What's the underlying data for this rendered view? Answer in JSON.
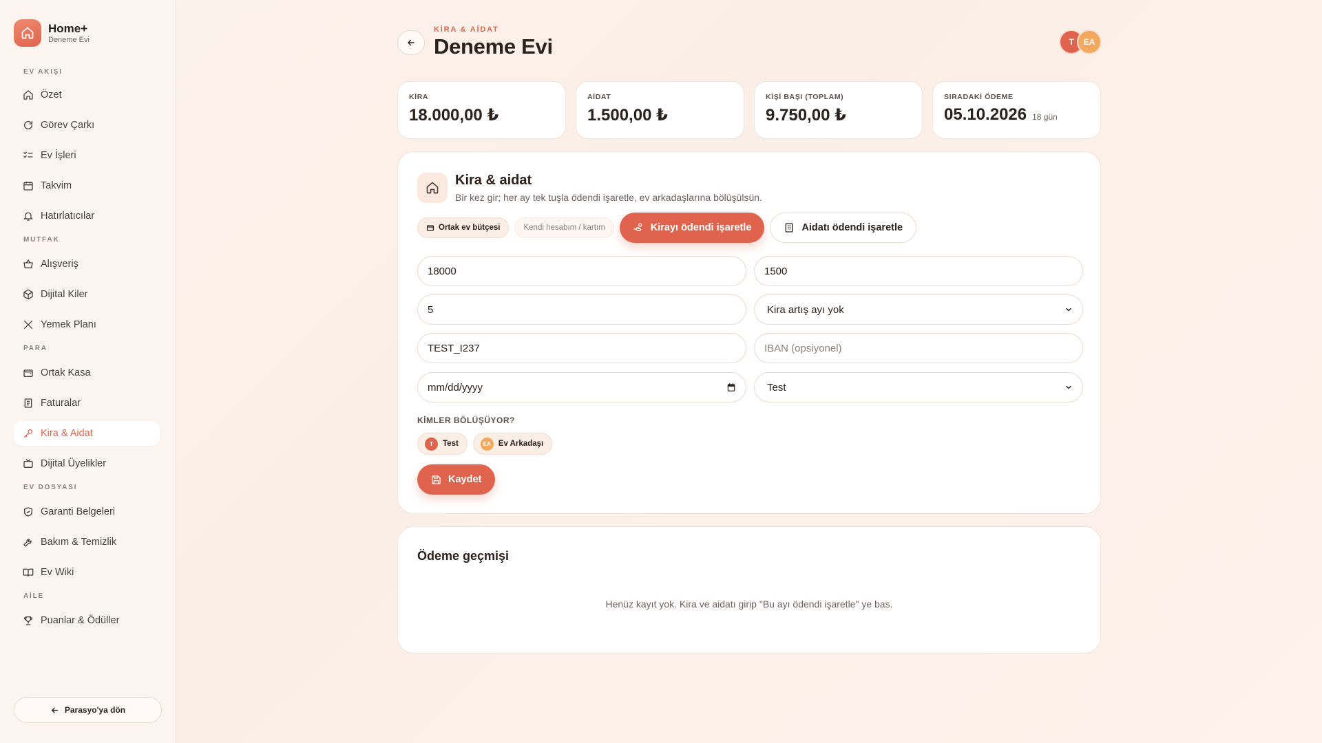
{
  "brand": {
    "title": "Home+",
    "subtitle": "Deneme Evi"
  },
  "sidebar": {
    "sections": [
      {
        "label": "EV AKIŞI",
        "items": [
          {
            "label": "Özet",
            "icon": "home-icon"
          },
          {
            "label": "Görev Çarkı",
            "icon": "refresh-icon"
          },
          {
            "label": "Ev İşleri",
            "icon": "checklist-icon"
          },
          {
            "label": "Takvim",
            "icon": "calendar-icon"
          },
          {
            "label": "Hatırlatıcılar",
            "icon": "bell-icon"
          }
        ]
      },
      {
        "label": "MUTFAK",
        "items": [
          {
            "label": "Alışveriş",
            "icon": "basket-icon"
          },
          {
            "label": "Dijital Kiler",
            "icon": "box-icon"
          },
          {
            "label": "Yemek Planı",
            "icon": "utensils-icon"
          }
        ]
      },
      {
        "label": "PARA",
        "items": [
          {
            "label": "Ortak Kasa",
            "icon": "wallet-icon"
          },
          {
            "label": "Faturalar",
            "icon": "receipt-icon"
          },
          {
            "label": "Kira & Aidat",
            "icon": "key-icon",
            "active": true
          },
          {
            "label": "Dijital Üyelikler",
            "icon": "tv-icon"
          }
        ]
      },
      {
        "label": "EV DOSYASI",
        "items": [
          {
            "label": "Garanti Belgeleri",
            "icon": "shield-icon"
          },
          {
            "label": "Bakım & Temizlik",
            "icon": "wrench-icon"
          },
          {
            "label": "Ev Wiki",
            "icon": "book-icon"
          }
        ]
      },
      {
        "label": "AİLE",
        "items": [
          {
            "label": "Puanlar & Ödüller",
            "icon": "trophy-icon"
          }
        ]
      }
    ],
    "back_label": "Parasyo'ya dön"
  },
  "header": {
    "eyebrow": "KİRA & AİDAT",
    "title": "Deneme Evi",
    "avatars": [
      "T",
      "EA"
    ]
  },
  "stats": [
    {
      "label": "KİRA",
      "value": "18.000,00 ₺",
      "hint": ""
    },
    {
      "label": "AİDAT",
      "value": "1.500,00 ₺",
      "hint": ""
    },
    {
      "label": "KİŞİ BAŞI (TOPLAM)",
      "value": "9.750,00 ₺",
      "hint": ""
    },
    {
      "label": "SIRADAKİ ÖDEME",
      "value": "05.10.2026",
      "hint": "18 gün"
    }
  ],
  "form_card": {
    "title": "Kira & aidat",
    "subtitle": "Bir kez gir; her ay tek tuşla ödendi işaretle, ev arkadaşlarına bölüşülsün.",
    "source_options": [
      "Ortak ev bütçesi",
      "Kendi hesabım / kartım"
    ],
    "mark_rent_label": "Kirayı ödendi işaretle",
    "mark_dues_label": "Aidatı ödendi işaretle",
    "fields": {
      "rent_amount": "18000",
      "dues_amount": "1500",
      "due_day": "5",
      "increase_month": "Kira artış ayı yok",
      "landlord": "TEST_I237",
      "iban_placeholder": "IBAN (opsiyonel)",
      "date_placeholder": "mm/dd/yyyy",
      "payer": "Test"
    },
    "sharers_label": "KİMLER BÖLÜŞÜYOR?",
    "sharers": [
      {
        "initials": "T",
        "name": "Test"
      },
      {
        "initials": "EA",
        "name": "Ev Arkadaşı"
      }
    ],
    "save_label": "Kaydet"
  },
  "history": {
    "title": "Ödeme geçmişi",
    "empty_text": "Henüz kayıt yok. Kira ve aidatı girip \"Bu ayı ödendi işaretle\" ye bas."
  },
  "colors": {
    "accent": "#e0634d",
    "accent_light": "#fbe9e0",
    "avatar_secondary": "#f3a85e"
  }
}
